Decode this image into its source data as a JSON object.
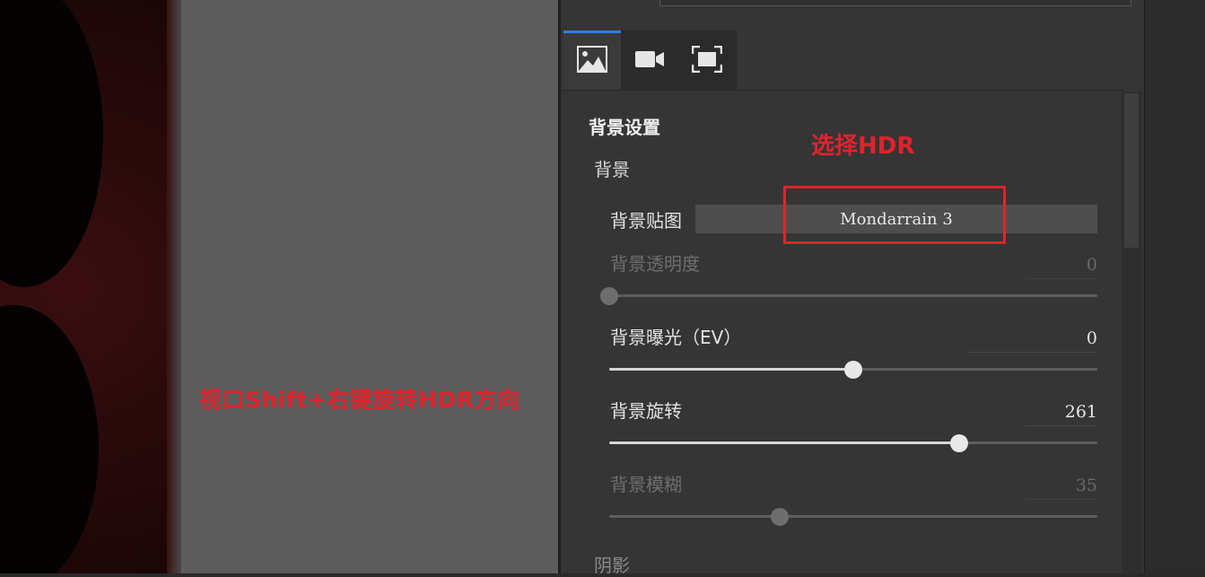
{
  "viewport": {
    "hint": "视口Shift+右键旋转HDR方向"
  },
  "panel": {
    "tabs": [
      {
        "icon": "image-icon",
        "active": true
      },
      {
        "icon": "video-camera-icon",
        "active": false
      },
      {
        "icon": "fullscreen-icon",
        "active": false
      }
    ],
    "section_title": "背景设置",
    "group_background": "背景",
    "bg_map": {
      "label": "背景贴图",
      "value": "Mondarrain 3"
    },
    "bg_opacity": {
      "label": "背景透明度",
      "value": "0",
      "fraction": 0.0
    },
    "bg_exposure": {
      "label": "背景曝光（EV）",
      "value": "0",
      "fraction": 0.5
    },
    "bg_rotation": {
      "label": "背景旋转",
      "value": "261",
      "fraction": 0.717
    },
    "bg_blur": {
      "label": "背景模糊",
      "value": "35",
      "fraction": 0.35
    },
    "group_shadow": "阴影",
    "annotation": "选择HDR"
  },
  "colors": {
    "accent": "#2f7fe0",
    "annotation_red": "#e0232b",
    "panel_bg": "#353535",
    "viewport_bg": "#5d5d5d"
  }
}
